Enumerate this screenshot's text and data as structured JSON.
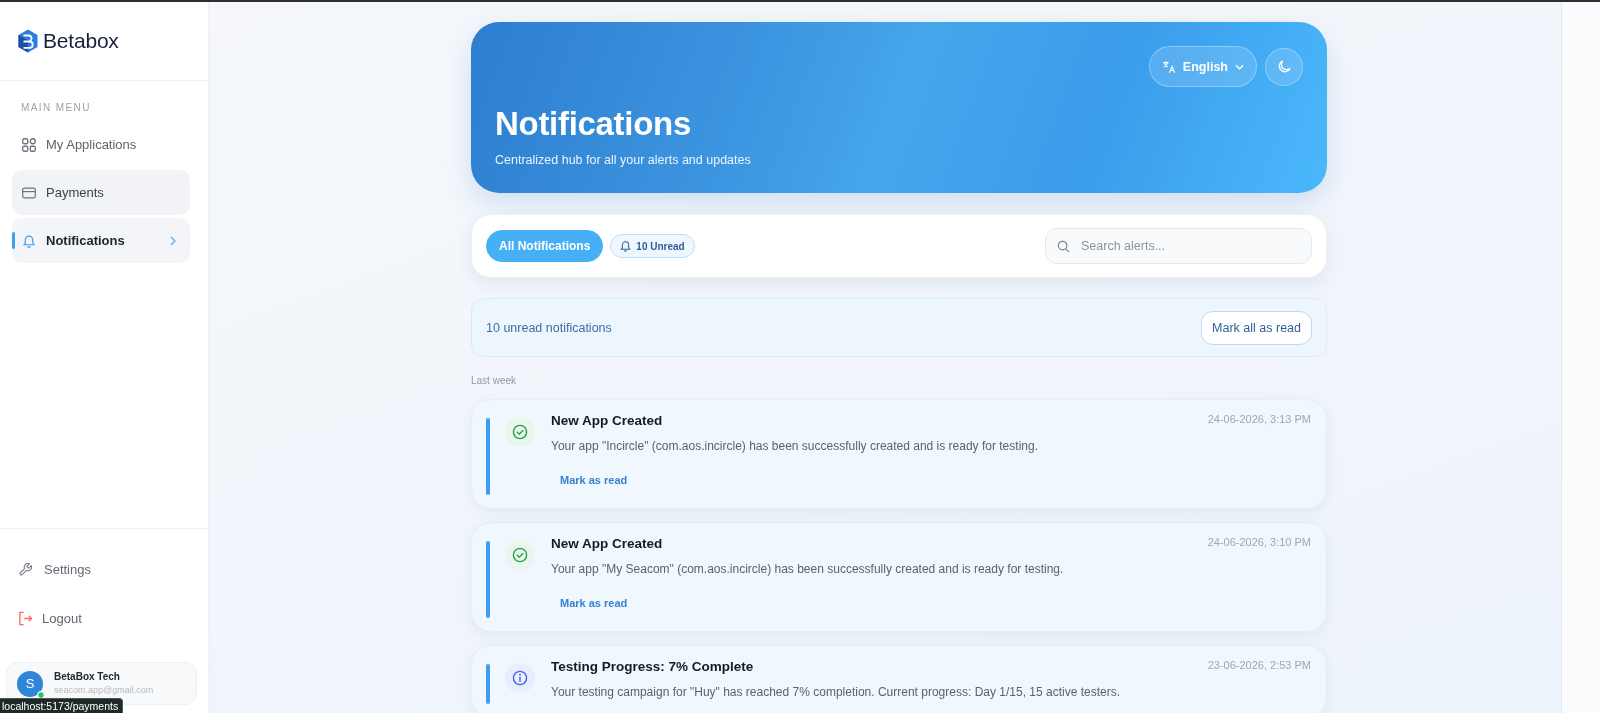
{
  "sidebar": {
    "brand": "Betabox",
    "section_label": "MAIN MENU",
    "menu": [
      {
        "label": "My Applications",
        "kind": "grid",
        "selected": false,
        "hovered": false
      },
      {
        "label": "Payments",
        "kind": "card",
        "selected": false,
        "hovered": true
      },
      {
        "label": "Notifications",
        "kind": "bell",
        "selected": true,
        "hovered": false
      }
    ],
    "footer_items": [
      {
        "label": "Settings",
        "kind": "settings"
      },
      {
        "label": "Logout",
        "kind": "logout"
      }
    ],
    "user": {
      "initial": "S",
      "name": "BetaBox Tech",
      "email": "seacom.app@gmail.com",
      "online": true
    }
  },
  "header": {
    "title": "Notifications",
    "subtitle": "Centralized hub for all your alerts and updates",
    "language": "English"
  },
  "filters": {
    "tabs": [
      {
        "label": "All Notifications",
        "kind": "all",
        "selected": true
      },
      {
        "label": "10 Unread",
        "kind": "unread",
        "selected": false
      }
    ],
    "search": {
      "placeholder": "Search alerts..."
    }
  },
  "summary": {
    "text": "10 unread notifications",
    "action": "Mark all as read"
  },
  "groups": [
    {
      "label": "Last week",
      "notifications": [
        {
          "kind": "success",
          "title": "New App Created",
          "message": "Your app \"Incircle\" (com.aos.incircle) has been successfully created and is ready for testing.",
          "time": "24-06-2026, 3:13 PM",
          "unread": true,
          "action": "Mark as read"
        },
        {
          "kind": "success",
          "title": "New App Created",
          "message": "Your app \"My Seacom\" (com.aos.incircle) has been successfully created and is ready for testing.",
          "time": "24-06-2026, 3:10 PM",
          "unread": true,
          "action": "Mark as read"
        },
        {
          "kind": "info",
          "title": "Testing Progress: 7% Complete",
          "message": "Your testing campaign for \"Huy\" has reached 7% completion. Current progress: Day 1/15, 15 active testers.",
          "time": "23-06-2026, 2:53 PM",
          "unread": true
        }
      ]
    }
  ],
  "status_url": "localhost:5173/payments"
}
